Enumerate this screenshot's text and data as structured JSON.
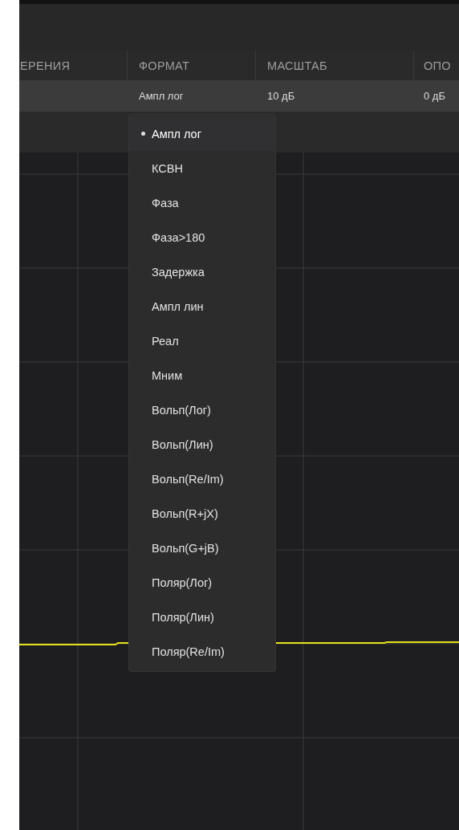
{
  "table": {
    "columns": [
      {
        "heading": "ЕРЕНИЯ"
      },
      {
        "heading": "ФОРМАТ",
        "value": "Ампл лог"
      },
      {
        "heading": "МАСШТАБ",
        "value": "10 дБ"
      },
      {
        "heading": "ОПО",
        "value": "0 дБ"
      }
    ]
  },
  "format_menu": {
    "items": [
      {
        "label": "Ампл лог",
        "selected": true
      },
      {
        "label": "КСВН",
        "selected": false
      },
      {
        "label": "Фаза",
        "selected": false
      },
      {
        "label": "Фаза>180",
        "selected": false
      },
      {
        "label": "Задержка",
        "selected": false
      },
      {
        "label": "Ампл лин",
        "selected": false
      },
      {
        "label": "Реал",
        "selected": false
      },
      {
        "label": "Мним",
        "selected": false
      },
      {
        "label": "Вольп(Лог)",
        "selected": false
      },
      {
        "label": "Вольп(Лин)",
        "selected": false
      },
      {
        "label": "Вольп(Re/Im)",
        "selected": false
      },
      {
        "label": "Вольп(R+jX)",
        "selected": false
      },
      {
        "label": "Вольп(G+jB)",
        "selected": false
      },
      {
        "label": "Поляр(Лог)",
        "selected": false
      },
      {
        "label": "Поляр(Лин)",
        "selected": false
      },
      {
        "label": "Поляр(Re/Im)",
        "selected": false
      }
    ]
  }
}
